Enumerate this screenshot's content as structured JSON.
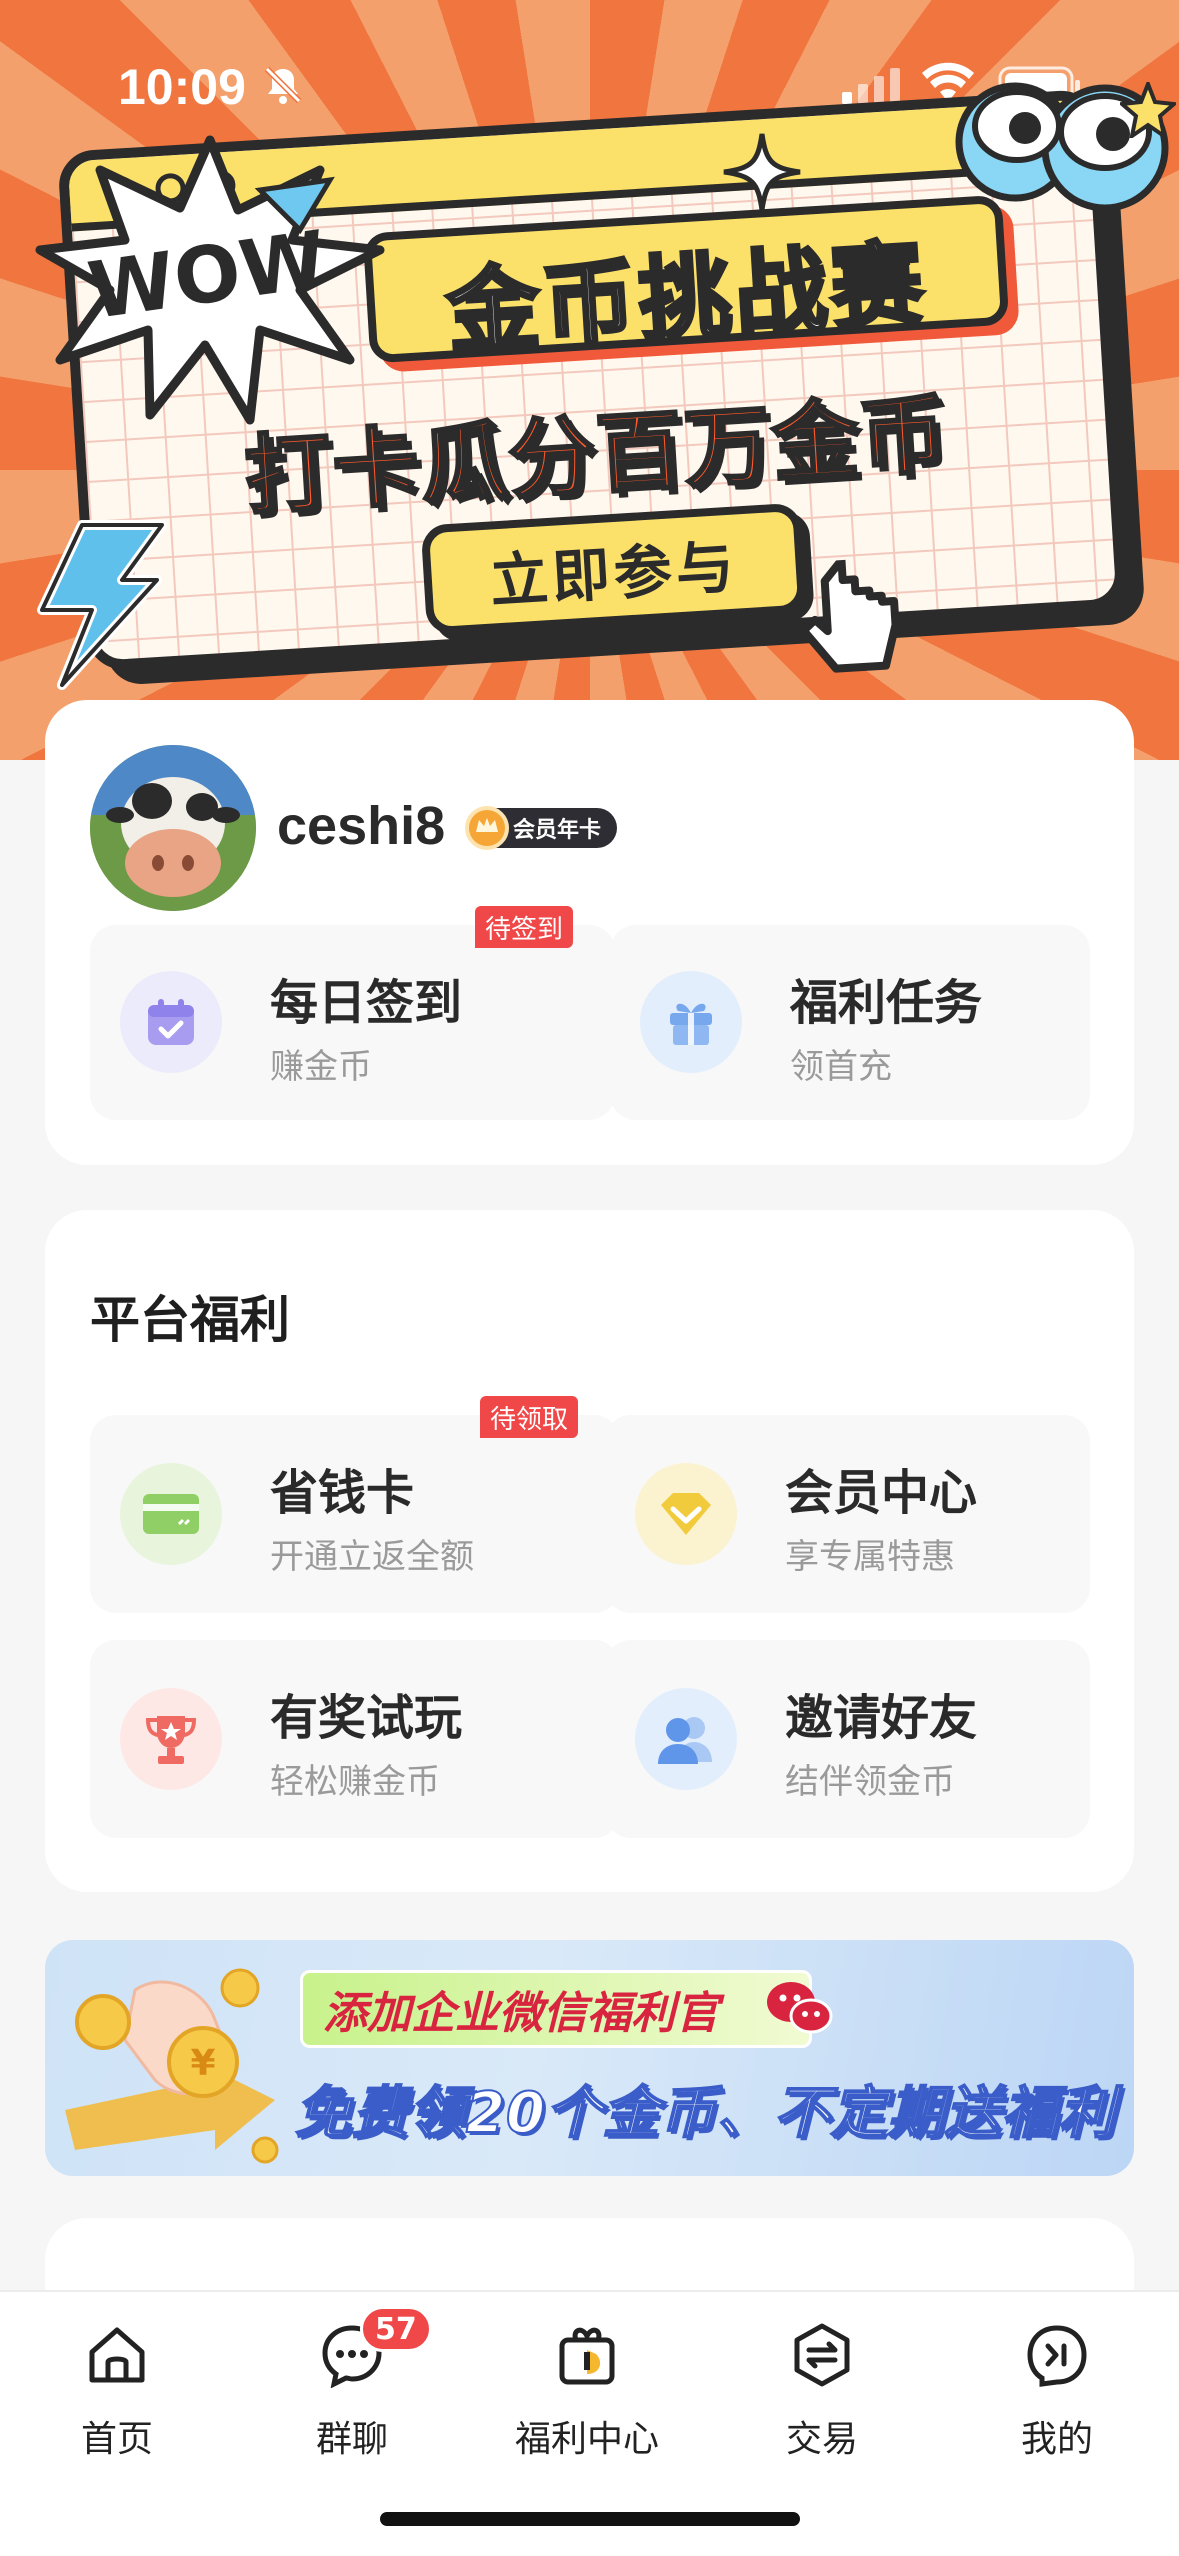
{
  "status_bar": {
    "time": "10:09"
  },
  "hero": {
    "badge": "WOW",
    "title": "金币挑战赛",
    "subtitle": "打卡瓜分百万金币",
    "cta": "立即参与"
  },
  "profile": {
    "username": "ceshi8",
    "member_badge": "会员年卡",
    "tiles": [
      {
        "title": "每日签到",
        "subtitle": "赚金币",
        "tag": "待签到",
        "icon": "calendar-check-icon"
      },
      {
        "title": "福利任务",
        "subtitle": "领首充",
        "icon": "gift-icon"
      }
    ]
  },
  "welfare": {
    "title": "平台福利",
    "tiles": [
      {
        "title": "省钱卡",
        "subtitle": "开通立返全额",
        "tag": "待领取",
        "icon": "card-icon"
      },
      {
        "title": "会员中心",
        "subtitle": "享专属特惠",
        "icon": "diamond-icon"
      },
      {
        "title": "有奖试玩",
        "subtitle": "轻松赚金币",
        "icon": "trophy-icon"
      },
      {
        "title": "邀请好友",
        "subtitle": "结伴领金币",
        "icon": "users-icon"
      }
    ]
  },
  "promo": {
    "line1": "添加企业微信福利官",
    "line2": "免费领20个金币、不定期送福利"
  },
  "tab_bar": {
    "tabs": [
      {
        "label": "首页",
        "icon": "home-icon"
      },
      {
        "label": "群聊",
        "icon": "chat-icon",
        "badge": "57"
      },
      {
        "label": "福利中心",
        "icon": "welfare-icon"
      },
      {
        "label": "交易",
        "icon": "trade-icon"
      },
      {
        "label": "我的",
        "icon": "profile-icon"
      }
    ]
  },
  "colors": {
    "accent_red": "#f04848",
    "hero_orange": "#f0753f",
    "banner_yellow": "#fbe16a"
  }
}
